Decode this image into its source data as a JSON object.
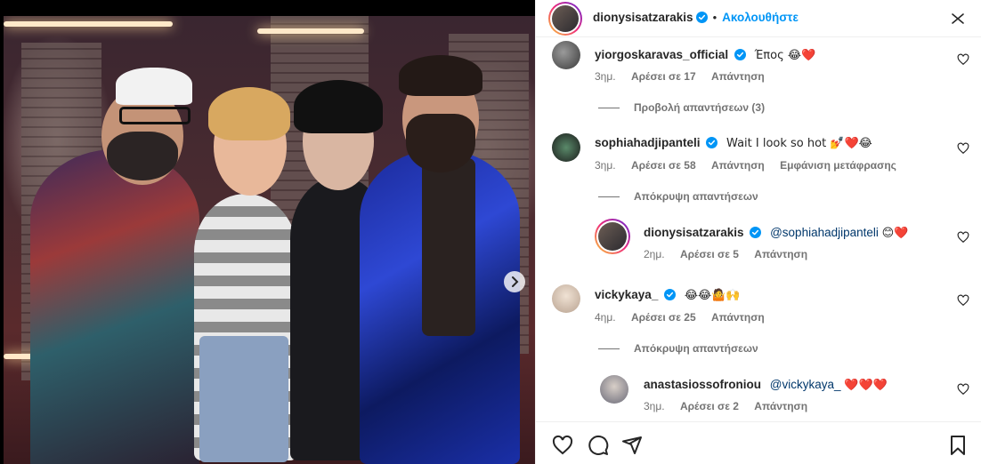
{
  "post": {
    "author": "dionysisatzarakis",
    "follow_label": "Ακολουθήστε",
    "separator": "•"
  },
  "photo": {
    "description_icon": "next-arrow"
  },
  "comments": [
    {
      "username": "yiorgoskaravas_official",
      "text": "Έπος 😂❤️",
      "age": "3ημ.",
      "likes": "Αρέσει σε 17",
      "reply_label": "Απάντηση",
      "view_replies": "Προβολή απαντήσεων (3)"
    },
    {
      "username": "sophiahadjipanteli",
      "text": "Wait I look so hot 💅❤️😂",
      "age": "3ημ.",
      "likes": "Αρέσει σε 58",
      "reply_label": "Απάντηση",
      "translate_label": "Εμφάνιση μετάφρασης",
      "hide_replies": "Απόκρυψη απαντήσεων"
    },
    {
      "username": "dionysisatzarakis",
      "mention": "@sophiahadjipanteli",
      "text": "😊❤️",
      "age": "2ημ.",
      "likes": "Αρέσει σε 5",
      "reply_label": "Απάντηση"
    },
    {
      "username": "vickykaya_",
      "text": "😂😂🤷🙌",
      "age": "4ημ.",
      "likes": "Αρέσει σε 25",
      "reply_label": "Απάντηση",
      "hide_replies": "Απόκρυψη απαντήσεων"
    },
    {
      "username": "anastasiossofroniou",
      "mention": "@vickykaya_",
      "text": "❤️❤️❤️",
      "age": "3ημ.",
      "likes": "Αρέσει σε 2",
      "reply_label": "Απάντηση"
    }
  ],
  "colors": {
    "accent": "#0095f6",
    "verified": "#0095f6",
    "meta_text": "#737373",
    "border": "#efefef"
  },
  "icons": [
    "more-icon",
    "heart-icon",
    "comment-icon",
    "share-icon",
    "bookmark-icon",
    "verified-icon",
    "chevron-right-icon"
  ]
}
